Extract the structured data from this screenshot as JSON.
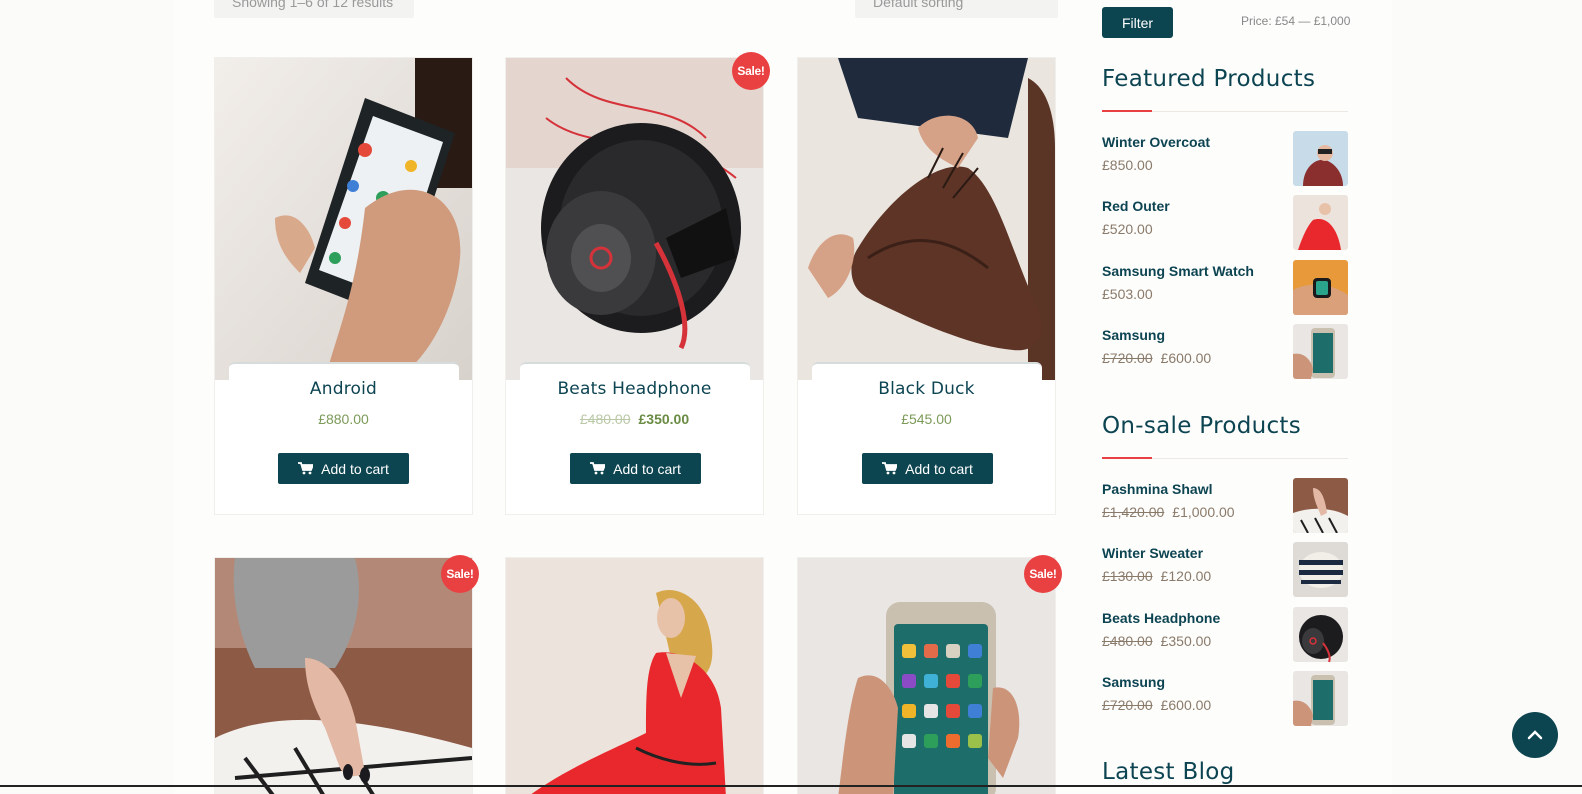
{
  "toolbar": {
    "result_count": "Showing 1–6 of 12 results",
    "sorting": "Default sorting"
  },
  "products": [
    {
      "title": "Android",
      "price": "£880.00",
      "old_price": "",
      "sale": false,
      "button": "Add to cart"
    },
    {
      "title": "Beats Headphone",
      "price": "£350.00",
      "old_price": "£480.00",
      "sale": true,
      "button": "Add to cart"
    },
    {
      "title": "Black Duck",
      "price": "£545.00",
      "old_price": "",
      "sale": false,
      "button": "Add to cart"
    },
    {
      "title": "",
      "sale": true
    },
    {
      "title": "",
      "sale": false
    },
    {
      "title": "",
      "sale": true
    }
  ],
  "sale_badge": "Sale!",
  "sidebar": {
    "filter_label": "Filter",
    "price_range": "Price: £54 — £1,000",
    "featured_title": "Featured Products",
    "featured": [
      {
        "name": "Winter Overcoat",
        "price": "£850.00",
        "old_price": ""
      },
      {
        "name": "Red Outer",
        "price": "£520.00",
        "old_price": ""
      },
      {
        "name": "Samsung Smart Watch",
        "price": "£503.00",
        "old_price": ""
      },
      {
        "name": "Samsung",
        "price": "£600.00",
        "old_price": "£720.00"
      }
    ],
    "onsale_title": "On-sale Products",
    "onsale": [
      {
        "name": "Pashmina Shawl",
        "price": "£1,000.00",
        "old_price": "£1,420.00"
      },
      {
        "name": "Winter Sweater",
        "price": "£120.00",
        "old_price": "£130.00"
      },
      {
        "name": "Beats Headphone",
        "price": "£350.00",
        "old_price": "£480.00"
      },
      {
        "name": "Samsung",
        "price": "£600.00",
        "old_price": "£720.00"
      }
    ],
    "blog_title": "Latest Blog"
  },
  "icons": {
    "cart": "cart-icon",
    "scroll_top": "chevron-up-icon"
  },
  "colors": {
    "primary": "#0c4450",
    "sale": "#e94141",
    "price_green": "#7c9a59"
  }
}
